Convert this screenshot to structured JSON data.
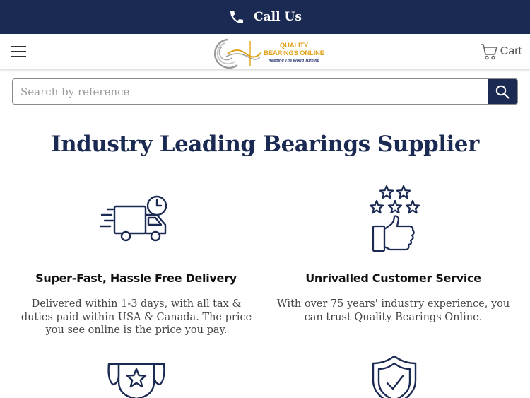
{
  "topbar": {
    "call_label": "Call Us",
    "icon": "phone-icon"
  },
  "header": {
    "menu_icon": "hamburger-icon",
    "logo": {
      "brand": "QUALITY BEARINGS ONLINE",
      "tagline": "Keeping The World Turning"
    },
    "cart_label": "Cart"
  },
  "search": {
    "placeholder": "Search by reference",
    "value": ""
  },
  "main": {
    "headline": "Industry Leading Bearings Supplier",
    "features": [
      {
        "icon": "delivery-truck-icon",
        "title": "Super-Fast, Hassle Free Delivery",
        "description": "Delivered within 1-3 days, with all tax & duties paid within USA & Canada. The price you see online is the price you pay."
      },
      {
        "icon": "stars-thumbs-up-icon",
        "title": "Unrivalled Customer Service",
        "description": "With over 75 years' industry experience, you can trust Quality Bearings Online."
      },
      {
        "icon": "trophy-star-icon",
        "title": "",
        "description": ""
      },
      {
        "icon": "shield-check-icon",
        "title": "",
        "description": ""
      }
    ]
  },
  "colors": {
    "navy": "#1b2a52",
    "gold": "#e0a21a"
  }
}
